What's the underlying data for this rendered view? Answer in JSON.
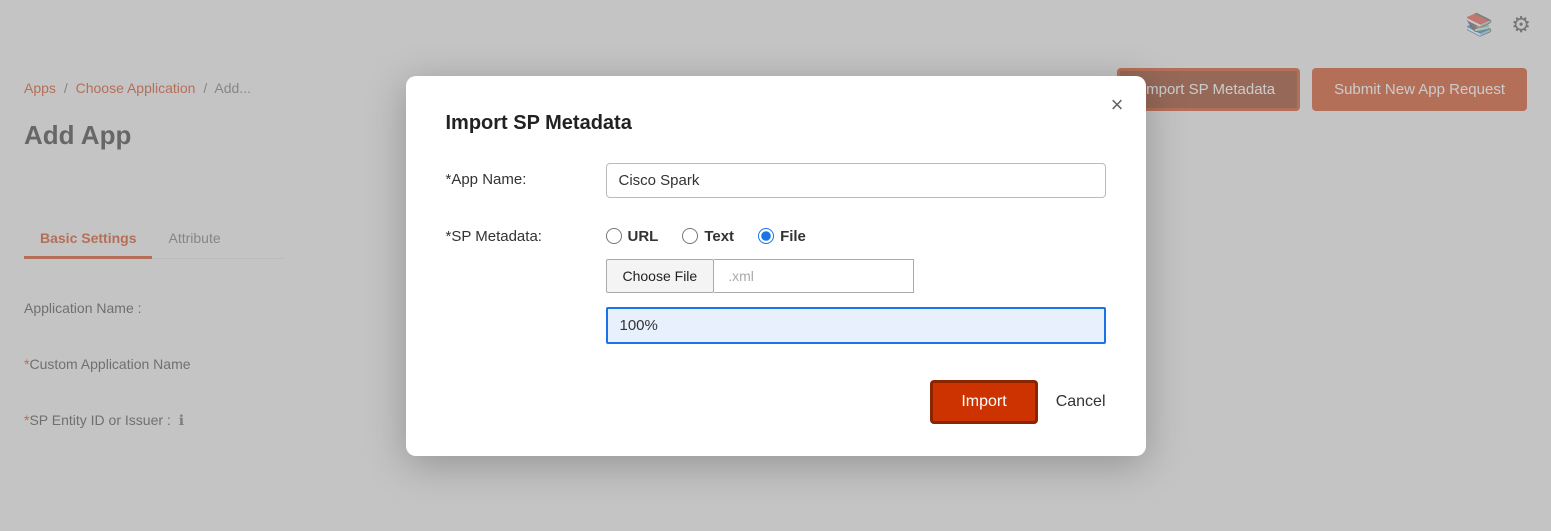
{
  "page": {
    "title": "Add App",
    "breadcrumb": {
      "items": [
        "Apps",
        "Choose Application",
        "Add..."
      ]
    }
  },
  "header": {
    "import_meta_label": "Import SP Metadata",
    "submit_new_label": "Submit New App Request"
  },
  "tabs": {
    "items": [
      {
        "label": "Basic Settings",
        "active": true
      },
      {
        "label": "Attribute",
        "active": false
      }
    ]
  },
  "bg_fields": [
    {
      "label": "Application Name :",
      "required": false
    },
    {
      "label": "Custom Application Name",
      "required": true
    },
    {
      "label": "SP Entity ID or Issuer :",
      "required": true
    }
  ],
  "modal": {
    "title": "Import SP Metadata",
    "close_label": "×",
    "app_name_label": "*App Name:",
    "app_name_value": "Cisco Spark",
    "sp_metadata_label": "*SP Metadata:",
    "radio_options": [
      {
        "label": "URL",
        "value": "url",
        "checked": false
      },
      {
        "label": "Text",
        "value": "text",
        "checked": false
      },
      {
        "label": "File",
        "value": "file",
        "checked": true
      }
    ],
    "choose_file_label": "Choose File",
    "file_display": ".xml",
    "progress_value": "100%",
    "import_btn_label": "Import",
    "cancel_btn_label": "Cancel"
  },
  "icons": {
    "book": "📖",
    "gear": "⚙"
  }
}
